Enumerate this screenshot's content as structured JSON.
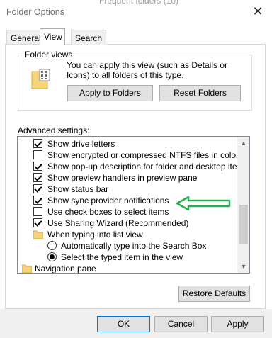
{
  "window": {
    "title": "Folder Options",
    "background_text": "Frequent folders (10)"
  },
  "tabs": [
    {
      "label": "General"
    },
    {
      "label": "View"
    },
    {
      "label": "Search"
    }
  ],
  "folder_views": {
    "title": "Folder views",
    "description": "You can apply this view (such as Details or Icons) to all folders of this type.",
    "apply_button": "Apply to Folders",
    "reset_button": "Reset Folders"
  },
  "advanced": {
    "label": "Advanced settings:",
    "items": [
      {
        "type": "checkbox",
        "checked": true,
        "label": "Show drive letters"
      },
      {
        "type": "checkbox",
        "checked": false,
        "label": "Show encrypted or compressed NTFS files in color"
      },
      {
        "type": "checkbox",
        "checked": true,
        "label": "Show pop-up description for folder and desktop items"
      },
      {
        "type": "checkbox",
        "checked": true,
        "label": "Show preview handlers in preview pane"
      },
      {
        "type": "checkbox",
        "checked": true,
        "label": "Show status bar"
      },
      {
        "type": "checkbox",
        "checked": true,
        "label": "Show sync provider notifications"
      },
      {
        "type": "checkbox",
        "checked": false,
        "label": "Use check boxes to select items"
      },
      {
        "type": "checkbox",
        "checked": true,
        "label": "Use Sharing Wizard (Recommended)"
      },
      {
        "type": "folder",
        "label": "When typing into list view"
      },
      {
        "type": "radio",
        "checked": false,
        "label": "Automatically type into the Search Box"
      },
      {
        "type": "radio",
        "checked": true,
        "label": "Select the typed item in the view"
      },
      {
        "type": "folder",
        "label": "Navigation pane"
      }
    ],
    "restore_button": "Restore Defaults"
  },
  "footer": {
    "ok": "OK",
    "cancel": "Cancel",
    "apply": "Apply"
  },
  "colors": {
    "annotation_arrow": "#22b14c"
  }
}
